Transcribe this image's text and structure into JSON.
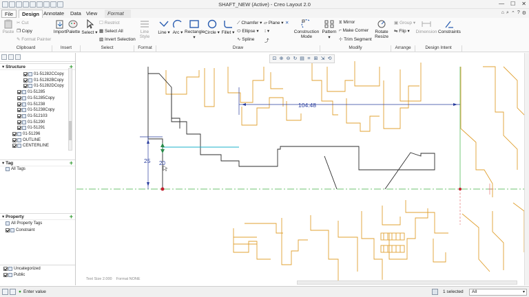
{
  "window": {
    "title": "SHAFT_NEW (Active) - Creo Layout 2.0"
  },
  "tabs": {
    "file": "File",
    "design": "Design",
    "annotate": "Annotate",
    "data": "Data",
    "view": "View",
    "format": "Format"
  },
  "ribbon": {
    "clipboard": {
      "paste": "Paste",
      "cut": "Cut",
      "copy": "Copy",
      "format_painter": "Format Painter",
      "label": "Clipboard"
    },
    "insert": {
      "import": "Import",
      "palette": "Palette",
      "label": "Insert"
    },
    "select": {
      "select": "Select",
      "restrict": "Restrict",
      "select_all": "Select All",
      "invert_selection": "Invert Selection",
      "label": "Select"
    },
    "format": {
      "line_style": "Line Style",
      "label": "Format"
    },
    "draw": {
      "line": "Line",
      "arc": "Arc",
      "rectangle": "Rectangle",
      "circle": "Circle",
      "fillet": "Fillet",
      "chamfer": "Chamfer",
      "plane": "Plane",
      "ellipse": "Ellipse",
      "spline": "Spline",
      "construction_mode": "Construction Mode",
      "label": "Draw"
    },
    "modify": {
      "pattern": "Pattern",
      "mirror": "Mirror",
      "make_corner": "Make Corner",
      "trim_segment": "Trim Segment",
      "rotate_resize": "Rotate Resize",
      "label": "Modify"
    },
    "arrange": {
      "group": "Group",
      "flip": "Flip",
      "label": "Arrange"
    },
    "design_intent": {
      "dimension": "Dimension",
      "constraints": "Constraints",
      "label": "Design Intent"
    }
  },
  "structure": {
    "title": "Structure",
    "items": [
      {
        "label": "01-51282CCopy",
        "checked": true
      },
      {
        "label": "01-51282BCopy",
        "checked": true
      },
      {
        "label": "01-51282DCopy",
        "checked": true
      },
      {
        "label": "01-51285",
        "checked": true
      },
      {
        "label": "01-51285Copy",
        "checked": true
      },
      {
        "label": "01-51238",
        "checked": true
      },
      {
        "label": "01-51238Copy",
        "checked": true
      },
      {
        "label": "01-512103",
        "checked": true
      },
      {
        "label": "01-51290",
        "checked": true
      },
      {
        "label": "01-51291",
        "checked": true
      },
      {
        "label": "01-51296",
        "checked": true
      },
      {
        "label": "OUTLINE",
        "checked": true
      },
      {
        "label": "CENTERLINE",
        "checked": true
      }
    ]
  },
  "tag": {
    "title": "Tag",
    "all_tags": "All Tags"
  },
  "property": {
    "title": "Property",
    "all_property_tags": "All Property Tags",
    "constraint": "Constraint"
  },
  "bottom_layers": {
    "uncategorized": "Uncategorized",
    "public": "Public"
  },
  "canvas": {
    "dim_horizontal": "104.48",
    "dim_vertical": "25",
    "dim_small": "20",
    "footer_text_size": "Text Size 2.000",
    "footer_format": "Format NONE"
  },
  "status": {
    "enter_value": "Enter value",
    "selected": "1 selected",
    "filter": "All"
  },
  "colors": {
    "outline": "#e0a030",
    "sketch": "#2b2b2b",
    "dimension": "#2a3e9e",
    "centerline": "#3cb043",
    "highlight": "#19b0c8"
  }
}
